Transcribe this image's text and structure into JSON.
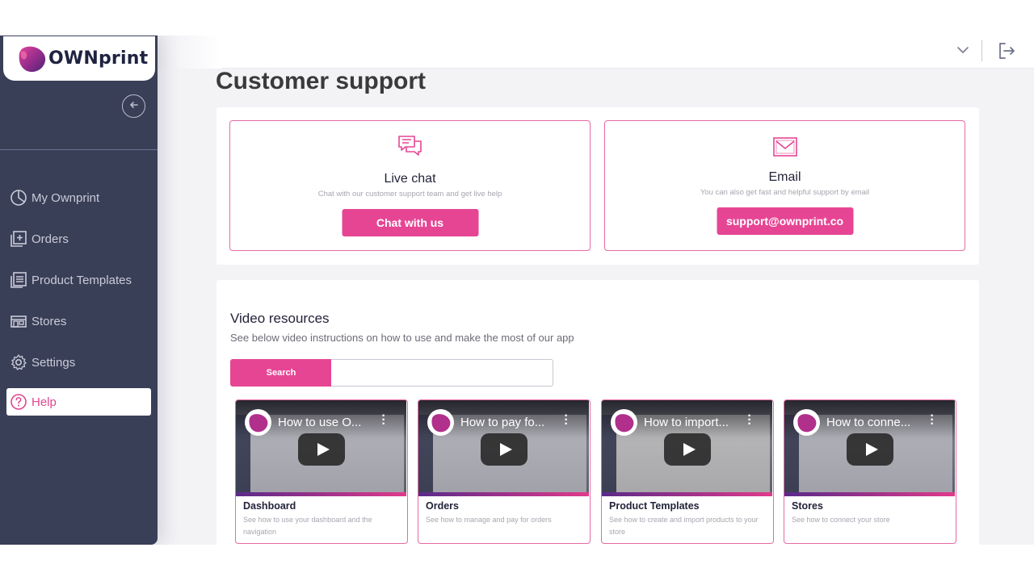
{
  "app": {
    "brand": "OWNprint",
    "accent": "#e64594",
    "sidebar_bg": "#3a3f58"
  },
  "sidebar": {
    "collapse_icon": "arrow-left-circle-icon",
    "items": [
      {
        "label": "My Ownprint",
        "icon": "pie-chart-icon"
      },
      {
        "label": "Orders",
        "icon": "add-box-icon"
      },
      {
        "label": "Product Templates",
        "icon": "list-icon"
      },
      {
        "label": "Stores",
        "icon": "store-icon"
      },
      {
        "label": "Settings",
        "icon": "gear-icon"
      },
      {
        "label": "Help",
        "icon": "help-circle-icon",
        "active": true
      }
    ]
  },
  "topbar": {
    "dropdown_icon": "chevron-down-icon",
    "logout_icon": "logout-icon"
  },
  "page": {
    "title": "Customer support"
  },
  "support": {
    "live_chat": {
      "icon": "chat-bubbles-icon",
      "title": "Live chat",
      "subtitle": "Chat with our customer support team and get live help",
      "button": "Chat with us"
    },
    "email": {
      "icon": "envelope-icon",
      "title": "Email",
      "subtitle": "You can also get fast and helpful support by email",
      "button": "support@ownprint.co"
    }
  },
  "video_resources": {
    "title": "Video resources",
    "subtitle": "See below video instructions on how to use and make the most of our app",
    "search_button": "Search",
    "search_value": "",
    "videos": [
      {
        "overlay_title": "How to use O...",
        "title": "Dashboard",
        "description": "See how to use your dashboard and the navigation"
      },
      {
        "overlay_title": "How to pay fo...",
        "title": "Orders",
        "description": "See how to manage and pay for orders"
      },
      {
        "overlay_title": "How to import...",
        "title": "Product Templates",
        "description": "See how to create and import products to your store"
      },
      {
        "overlay_title": "How to conne...",
        "title": "Stores",
        "description": "See how to connect your store"
      }
    ]
  }
}
